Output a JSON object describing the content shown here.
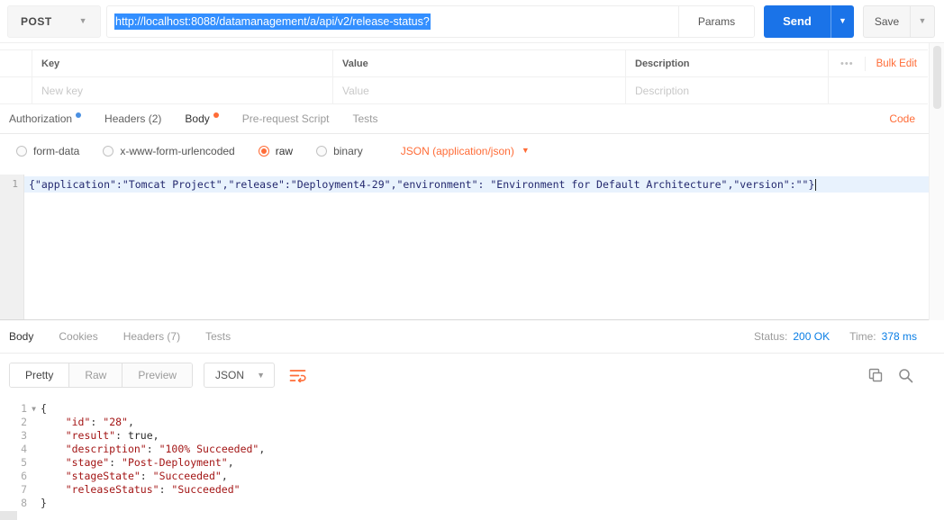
{
  "colors": {
    "accent_orange": "#ff6c37",
    "send_blue": "#1a73e8",
    "status_blue": "#0a7ee5",
    "selection_blue": "#338fff"
  },
  "request_bar": {
    "method": "POST",
    "url": "http://localhost:8088/datamanagement/a/api/v2/release-status?",
    "params_label": "Params",
    "send_label": "Send",
    "save_label": "Save"
  },
  "kv_editor": {
    "columns": {
      "key": "Key",
      "value": "Value",
      "description": "Description"
    },
    "menu_icon": "•••",
    "bulk_edit_label": "Bulk Edit",
    "placeholders": {
      "key": "New key",
      "value": "Value",
      "description": "Description"
    }
  },
  "request_tabs": {
    "authorization": "Authorization",
    "headers": "Headers (2)",
    "body": "Body",
    "pre_request_script": "Pre-request Script",
    "tests": "Tests",
    "code_link": "Code"
  },
  "body_options": {
    "form_data": "form-data",
    "urlencoded": "x-www-form-urlencoded",
    "raw": "raw",
    "binary": "binary",
    "selected": "raw",
    "content_type": "JSON (application/json)"
  },
  "request_editor": {
    "line_number": "1",
    "code": "{\"application\":\"Tomcat Project\",\"release\":\"Deployment4-29\",\"environment\": \"Environment for Default Architecture\",\"version\":\"\"}"
  },
  "response": {
    "tabs": {
      "body": "Body",
      "cookies": "Cookies",
      "headers": "Headers (7)",
      "tests": "Tests"
    },
    "status_label": "Status:",
    "status_value": "200 OK",
    "time_label": "Time:",
    "time_value": "378 ms",
    "view_modes": {
      "pretty": "Pretty",
      "raw": "Raw",
      "preview": "Preview"
    },
    "format_select": "JSON",
    "body_lines": [
      "{",
      "    \"id\": \"28\",",
      "    \"result\": true,",
      "    \"description\": \"100% Succeeded\",",
      "    \"stage\": \"Post-Deployment\",",
      "    \"stageState\": \"Succeeded\",",
      "    \"releaseStatus\": \"Succeeded\"",
      "}"
    ]
  }
}
